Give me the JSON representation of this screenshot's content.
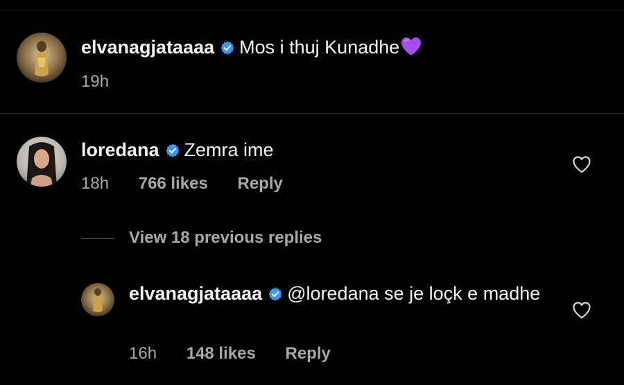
{
  "comments": [
    {
      "username": "elvanagjataaaa",
      "verified": true,
      "text": "Mos i thuj Kunadhe",
      "emoji": "purple-heart",
      "time": "19h"
    },
    {
      "username": "loredana",
      "verified": true,
      "text": "Zemra ime",
      "time": "18h",
      "likes": "766 likes",
      "reply_label": "Reply",
      "view_replies": "View 18 previous replies",
      "replies": [
        {
          "username": "elvanagjataaaa",
          "verified": true,
          "mention": "@loredana",
          "text": " se je loçk e madhe",
          "time": "16h",
          "likes": "148 likes",
          "reply_label": "Reply"
        }
      ]
    }
  ],
  "colors": {
    "background": "#000000",
    "primary_text": "#f5f5f5",
    "secondary_text": "#a8a8a8",
    "verified_badge": "#3897f0",
    "purple_heart": "#a64cf0"
  }
}
